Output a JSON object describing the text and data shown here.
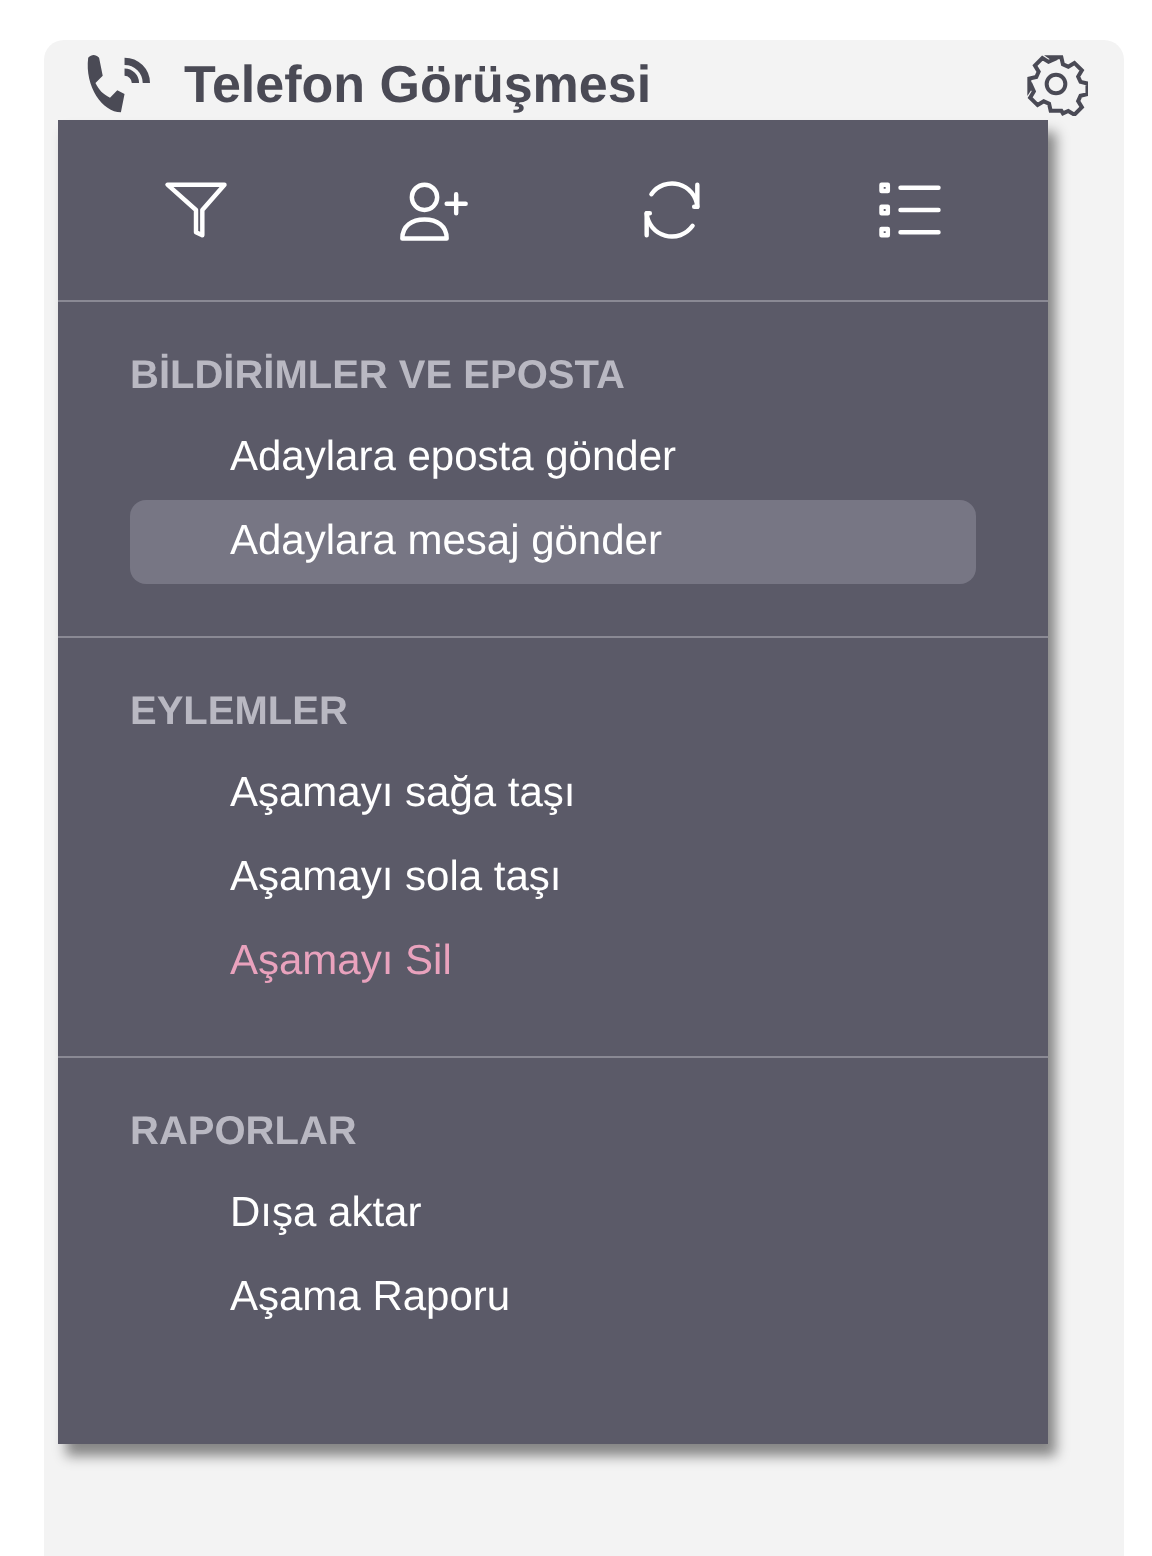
{
  "card": {
    "title": "Telefon Görüşmesi"
  },
  "menu": {
    "sections": [
      {
        "heading": "BİLDİRİMLER VE EPOSTA",
        "items": [
          {
            "label": "Adaylara eposta gönder",
            "selected": false,
            "kind": "normal"
          },
          {
            "label": "Adaylara mesaj gönder",
            "selected": true,
            "kind": "normal"
          }
        ]
      },
      {
        "heading": "EYLEMLER",
        "items": [
          {
            "label": "Aşamayı sağa taşı",
            "selected": false,
            "kind": "normal"
          },
          {
            "label": "Aşamayı sola taşı",
            "selected": false,
            "kind": "normal"
          },
          {
            "label": "Aşamayı Sil",
            "selected": false,
            "kind": "danger"
          }
        ]
      },
      {
        "heading": "RAPORLAR",
        "items": [
          {
            "label": "Dışa aktar",
            "selected": false,
            "kind": "normal"
          },
          {
            "label": "Aşama Raporu",
            "selected": false,
            "kind": "normal"
          }
        ]
      }
    ]
  }
}
